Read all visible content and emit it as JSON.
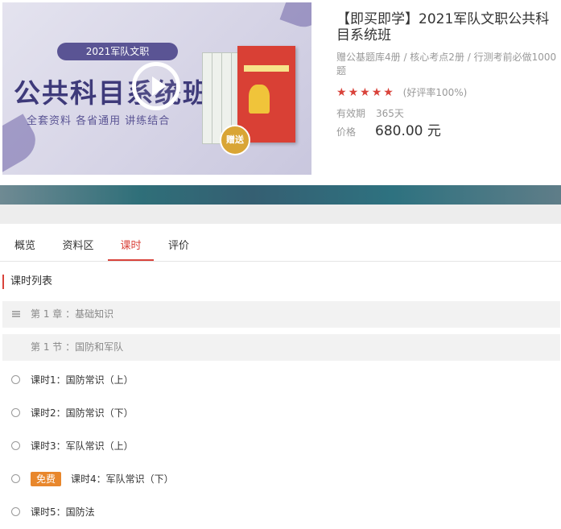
{
  "course": {
    "title": "【即买即学】2021军队文职公共科目系统班",
    "description": "赠公基题库4册 / 核心考点2册 / 行测考前必做1000题",
    "rating_text": "(好评率100%)",
    "stars": 5,
    "validity_label": "有效期",
    "validity_value": "365天",
    "price_label": "价格",
    "price_value": "680.00 元",
    "accent_color": "#d9433b"
  },
  "cover": {
    "pill_text": "2021军队文职",
    "title_text": "公共科目系统班",
    "subtitle_text": "全套资料  各省通用  讲练结合",
    "badge_text": "赠送",
    "play_icon": "play-icon"
  },
  "tabs": [
    {
      "label": "概览"
    },
    {
      "label": "资料区"
    },
    {
      "label": "课时",
      "active": true
    },
    {
      "label": "评价"
    }
  ],
  "lesson_list": {
    "heading": "课时列表",
    "chapter": "第 1 章 ：基础知识",
    "section": "第 1 节 ：国防和军队",
    "free_badge": "免费",
    "lessons": [
      {
        "title": "课时1：国防常识（上）"
      },
      {
        "title": "课时2：国防常识（下）"
      },
      {
        "title": "课时3：军队常识（上）"
      },
      {
        "title": "课时4：军队常识（下）",
        "free": true
      },
      {
        "title": "课时5：国防法"
      }
    ]
  }
}
